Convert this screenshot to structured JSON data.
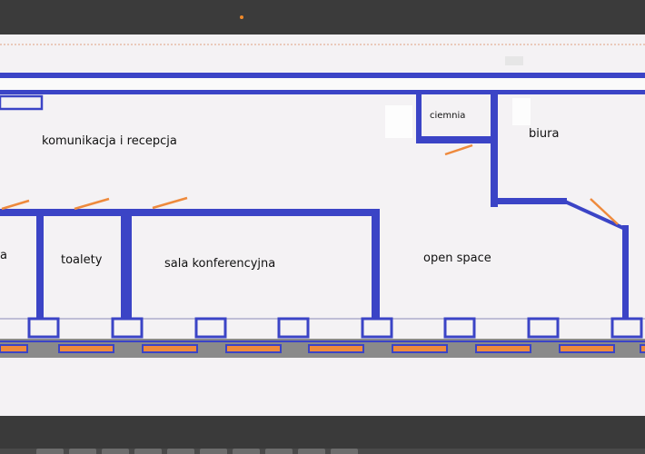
{
  "floor_plan": {
    "rooms": [
      {
        "id": "komunikacja",
        "label": "komunikacja i recepcja"
      },
      {
        "id": "ciemnia",
        "label": "ciemnia"
      },
      {
        "id": "biura",
        "label": "biura"
      },
      {
        "id": "partial",
        "label": "a"
      },
      {
        "id": "toalety",
        "label": "toalety"
      },
      {
        "id": "sala",
        "label": "sala konferencyjna"
      },
      {
        "id": "openspace",
        "label": "open space"
      }
    ]
  },
  "colors": {
    "wall": "#3b44c6",
    "door_swing": "#ee8a3c",
    "canvas": "#f4f2f4",
    "dark_ui": "#3a3a3a",
    "window_fill": "#ee8a3c"
  }
}
